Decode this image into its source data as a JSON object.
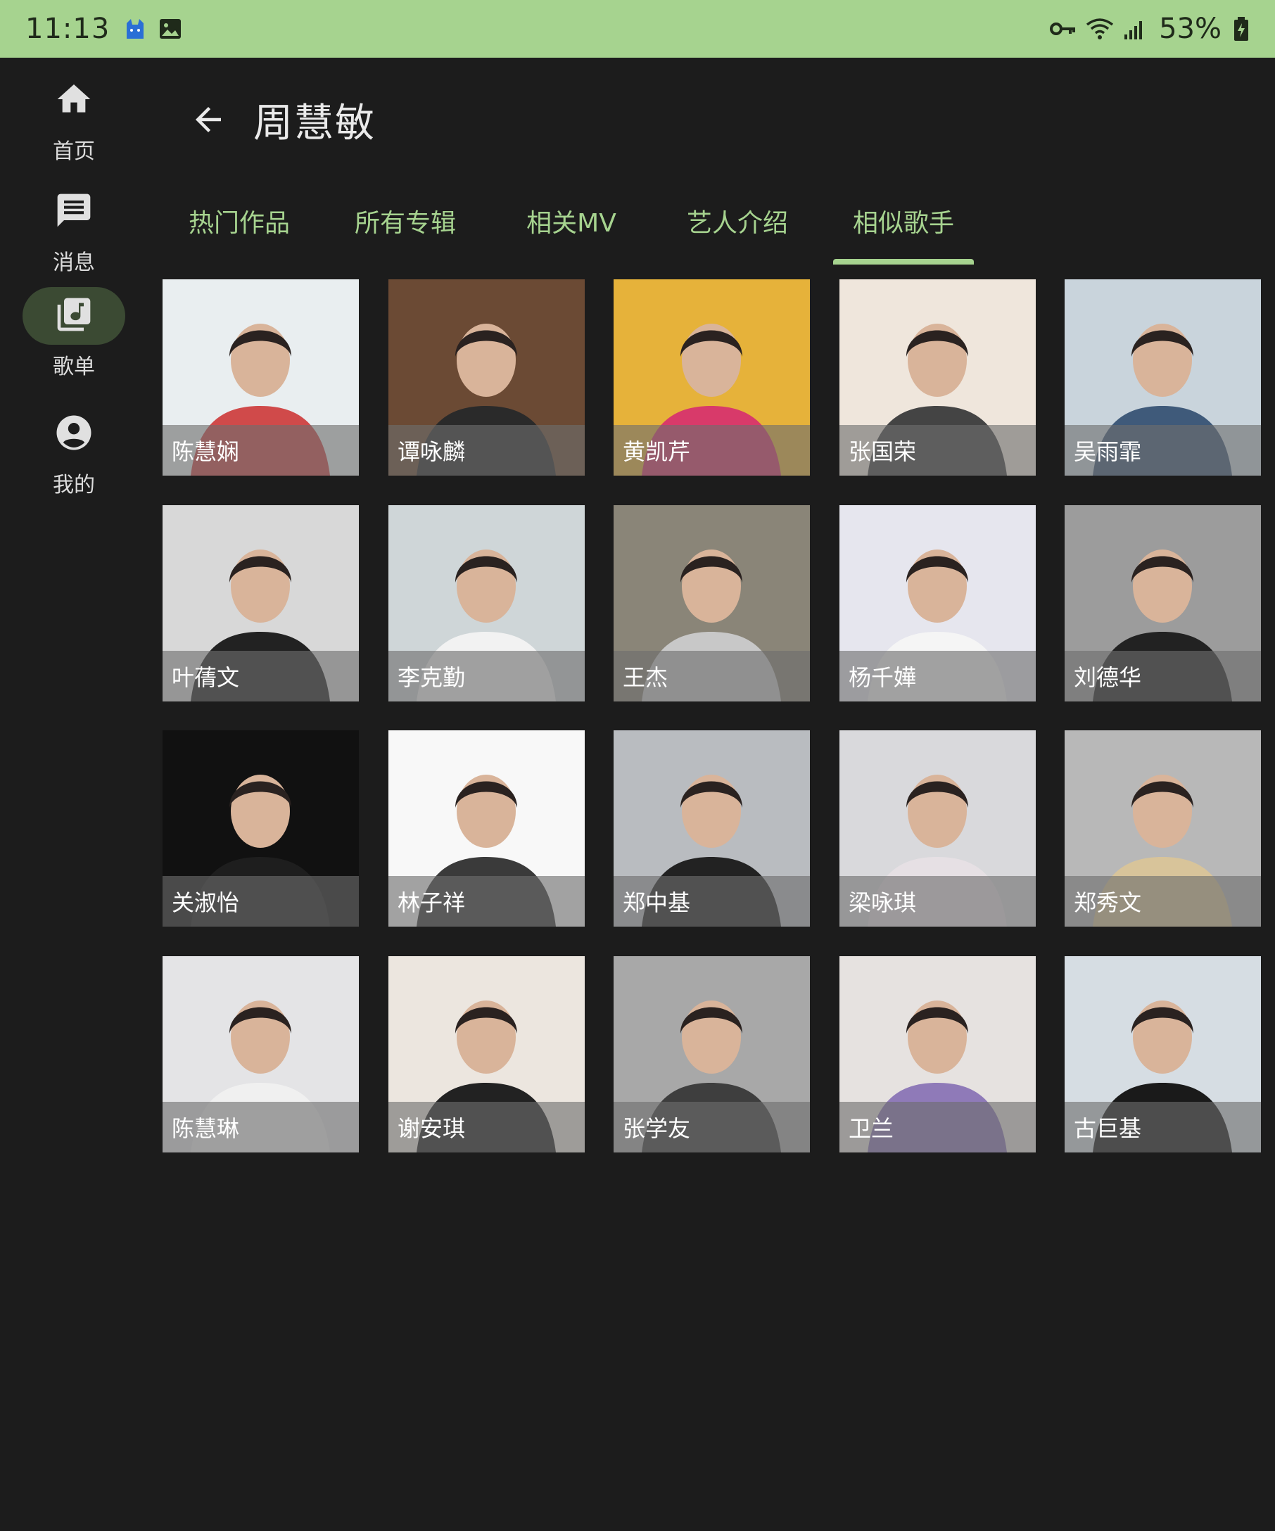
{
  "status_bar": {
    "time": "11:13",
    "battery": "53%",
    "icons": [
      "cat-notification-icon",
      "image-notification-icon",
      "vpn-key-icon",
      "wifi-icon",
      "signal-icon",
      "battery-charging-icon"
    ]
  },
  "rail": {
    "items": [
      {
        "label": "首页",
        "icon": "home-icon",
        "active": false
      },
      {
        "label": "消息",
        "icon": "message-icon",
        "active": false
      },
      {
        "label": "歌单",
        "icon": "library-music-icon",
        "active": true
      },
      {
        "label": "我的",
        "icon": "account-icon",
        "active": false
      }
    ]
  },
  "header": {
    "title": "周慧敏",
    "back_icon": "arrow-back-icon"
  },
  "tabs": [
    {
      "label": "热门作品",
      "active": false
    },
    {
      "label": "所有专辑",
      "active": false
    },
    {
      "label": "相关MV",
      "active": false
    },
    {
      "label": "艺人介绍",
      "active": false
    },
    {
      "label": "相似歌手",
      "active": true
    }
  ],
  "colors": {
    "accent": "#a6d38f",
    "background": "#1c1c1c",
    "rail_active": "#3b4a33"
  },
  "artists": [
    {
      "name": "陈慧娴"
    },
    {
      "name": "谭咏麟"
    },
    {
      "name": "黄凯芹"
    },
    {
      "name": "张国荣"
    },
    {
      "name": "吴雨霏"
    },
    {
      "name": "叶蒨文"
    },
    {
      "name": "李克勤"
    },
    {
      "name": "王杰"
    },
    {
      "name": "杨千嬅"
    },
    {
      "name": "刘德华"
    },
    {
      "name": "关淑怡"
    },
    {
      "name": "林子祥"
    },
    {
      "name": "郑中基"
    },
    {
      "name": "梁咏琪"
    },
    {
      "name": "郑秀文"
    },
    {
      "name": "陈慧琳"
    },
    {
      "name": "谢安琪"
    },
    {
      "name": "张学友"
    },
    {
      "name": "卫兰"
    },
    {
      "name": "古巨基"
    }
  ]
}
